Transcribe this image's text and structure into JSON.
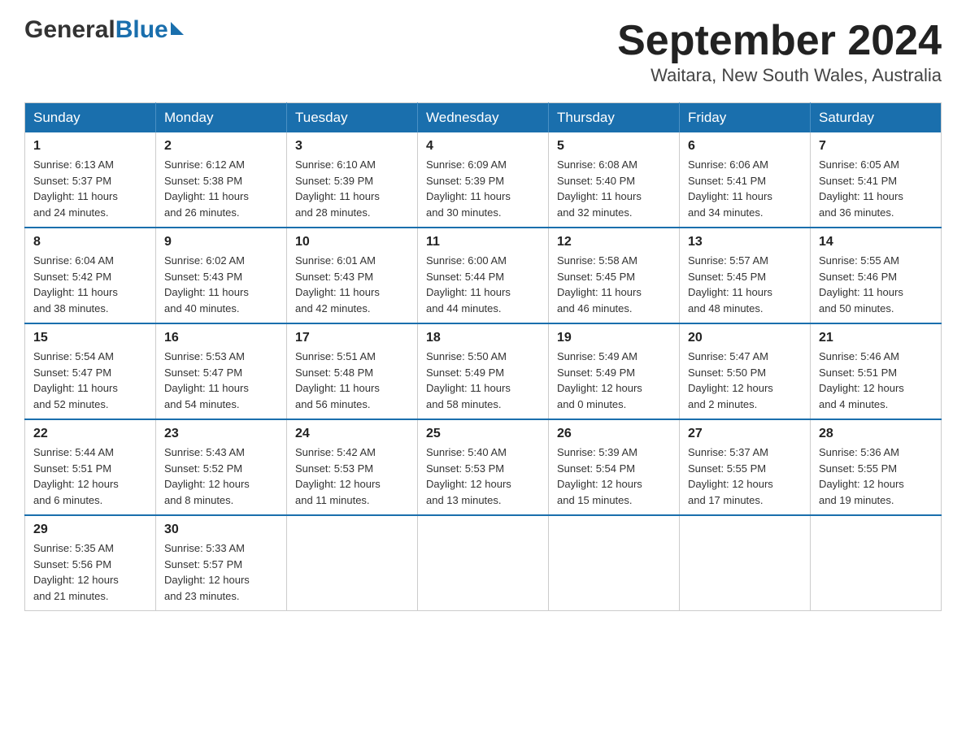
{
  "header": {
    "logo_general": "General",
    "logo_blue": "Blue",
    "month_title": "September 2024",
    "location": "Waitara, New South Wales, Australia"
  },
  "days_of_week": [
    "Sunday",
    "Monday",
    "Tuesday",
    "Wednesday",
    "Thursday",
    "Friday",
    "Saturday"
  ],
  "weeks": [
    [
      {
        "day": "1",
        "sunrise": "6:13 AM",
        "sunset": "5:37 PM",
        "daylight": "11 hours and 24 minutes."
      },
      {
        "day": "2",
        "sunrise": "6:12 AM",
        "sunset": "5:38 PM",
        "daylight": "11 hours and 26 minutes."
      },
      {
        "day": "3",
        "sunrise": "6:10 AM",
        "sunset": "5:39 PM",
        "daylight": "11 hours and 28 minutes."
      },
      {
        "day": "4",
        "sunrise": "6:09 AM",
        "sunset": "5:39 PM",
        "daylight": "11 hours and 30 minutes."
      },
      {
        "day": "5",
        "sunrise": "6:08 AM",
        "sunset": "5:40 PM",
        "daylight": "11 hours and 32 minutes."
      },
      {
        "day": "6",
        "sunrise": "6:06 AM",
        "sunset": "5:41 PM",
        "daylight": "11 hours and 34 minutes."
      },
      {
        "day": "7",
        "sunrise": "6:05 AM",
        "sunset": "5:41 PM",
        "daylight": "11 hours and 36 minutes."
      }
    ],
    [
      {
        "day": "8",
        "sunrise": "6:04 AM",
        "sunset": "5:42 PM",
        "daylight": "11 hours and 38 minutes."
      },
      {
        "day": "9",
        "sunrise": "6:02 AM",
        "sunset": "5:43 PM",
        "daylight": "11 hours and 40 minutes."
      },
      {
        "day": "10",
        "sunrise": "6:01 AM",
        "sunset": "5:43 PM",
        "daylight": "11 hours and 42 minutes."
      },
      {
        "day": "11",
        "sunrise": "6:00 AM",
        "sunset": "5:44 PM",
        "daylight": "11 hours and 44 minutes."
      },
      {
        "day": "12",
        "sunrise": "5:58 AM",
        "sunset": "5:45 PM",
        "daylight": "11 hours and 46 minutes."
      },
      {
        "day": "13",
        "sunrise": "5:57 AM",
        "sunset": "5:45 PM",
        "daylight": "11 hours and 48 minutes."
      },
      {
        "day": "14",
        "sunrise": "5:55 AM",
        "sunset": "5:46 PM",
        "daylight": "11 hours and 50 minutes."
      }
    ],
    [
      {
        "day": "15",
        "sunrise": "5:54 AM",
        "sunset": "5:47 PM",
        "daylight": "11 hours and 52 minutes."
      },
      {
        "day": "16",
        "sunrise": "5:53 AM",
        "sunset": "5:47 PM",
        "daylight": "11 hours and 54 minutes."
      },
      {
        "day": "17",
        "sunrise": "5:51 AM",
        "sunset": "5:48 PM",
        "daylight": "11 hours and 56 minutes."
      },
      {
        "day": "18",
        "sunrise": "5:50 AM",
        "sunset": "5:49 PM",
        "daylight": "11 hours and 58 minutes."
      },
      {
        "day": "19",
        "sunrise": "5:49 AM",
        "sunset": "5:49 PM",
        "daylight": "12 hours and 0 minutes."
      },
      {
        "day": "20",
        "sunrise": "5:47 AM",
        "sunset": "5:50 PM",
        "daylight": "12 hours and 2 minutes."
      },
      {
        "day": "21",
        "sunrise": "5:46 AM",
        "sunset": "5:51 PM",
        "daylight": "12 hours and 4 minutes."
      }
    ],
    [
      {
        "day": "22",
        "sunrise": "5:44 AM",
        "sunset": "5:51 PM",
        "daylight": "12 hours and 6 minutes."
      },
      {
        "day": "23",
        "sunrise": "5:43 AM",
        "sunset": "5:52 PM",
        "daylight": "12 hours and 8 minutes."
      },
      {
        "day": "24",
        "sunrise": "5:42 AM",
        "sunset": "5:53 PM",
        "daylight": "12 hours and 11 minutes."
      },
      {
        "day": "25",
        "sunrise": "5:40 AM",
        "sunset": "5:53 PM",
        "daylight": "12 hours and 13 minutes."
      },
      {
        "day": "26",
        "sunrise": "5:39 AM",
        "sunset": "5:54 PM",
        "daylight": "12 hours and 15 minutes."
      },
      {
        "day": "27",
        "sunrise": "5:37 AM",
        "sunset": "5:55 PM",
        "daylight": "12 hours and 17 minutes."
      },
      {
        "day": "28",
        "sunrise": "5:36 AM",
        "sunset": "5:55 PM",
        "daylight": "12 hours and 19 minutes."
      }
    ],
    [
      {
        "day": "29",
        "sunrise": "5:35 AM",
        "sunset": "5:56 PM",
        "daylight": "12 hours and 21 minutes."
      },
      {
        "day": "30",
        "sunrise": "5:33 AM",
        "sunset": "5:57 PM",
        "daylight": "12 hours and 23 minutes."
      },
      null,
      null,
      null,
      null,
      null
    ]
  ],
  "labels": {
    "sunrise": "Sunrise:",
    "sunset": "Sunset:",
    "daylight": "Daylight:"
  }
}
